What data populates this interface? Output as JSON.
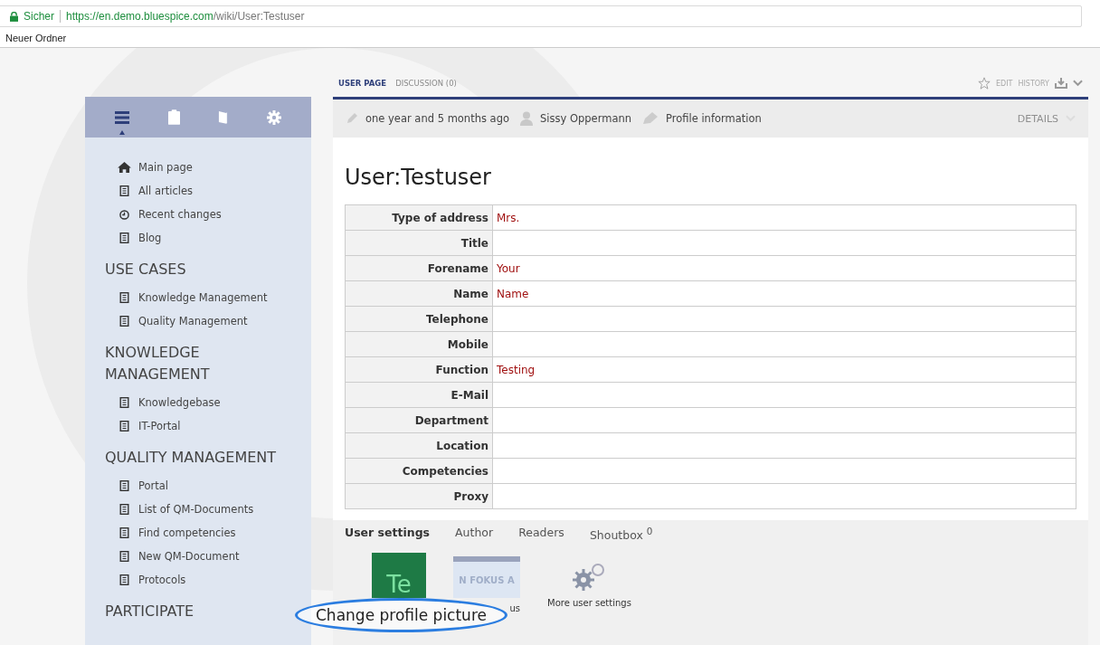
{
  "browser": {
    "secure_label": "Sicher",
    "url_host": "https://en.demo.bluespice.com",
    "url_path": "/wiki/User:Testuser",
    "bookmarks": [
      "Neuer Ordner"
    ]
  },
  "sidebar": {
    "tabs": [
      {
        "kind": "menu",
        "selected": true
      },
      {
        "kind": "clipboard",
        "selected": false
      },
      {
        "kind": "book",
        "selected": false
      },
      {
        "kind": "gear",
        "selected": false
      }
    ],
    "sections": [
      {
        "items": [
          {
            "kind": "home",
            "label": "Main page"
          },
          {
            "kind": "page",
            "label": "All articles"
          },
          {
            "kind": "clock",
            "label": "Recent changes"
          },
          {
            "kind": "page",
            "label": "Blog"
          }
        ]
      },
      {
        "heading": "USE CASES",
        "items": [
          {
            "kind": "page",
            "label": "Knowledge Management"
          },
          {
            "kind": "page",
            "label": "Quality Management"
          }
        ]
      },
      {
        "heading": "KNOWLEDGE MANAGEMENT",
        "items": [
          {
            "kind": "page",
            "label": "Knowledgebase"
          },
          {
            "kind": "page",
            "label": "IT-Portal"
          }
        ]
      },
      {
        "heading": "QUALITY MANAGEMENT",
        "items": [
          {
            "kind": "page",
            "label": "Portal"
          },
          {
            "kind": "page",
            "label": "List of QM-Documents"
          },
          {
            "kind": "page",
            "label": "Find competencies"
          },
          {
            "kind": "page",
            "label": "New QM-Document"
          },
          {
            "kind": "page",
            "label": "Protocols"
          }
        ]
      },
      {
        "heading": "PARTICIPATE"
      }
    ]
  },
  "page_tabs": [
    {
      "label": "USER PAGE",
      "selected": true
    },
    {
      "label": "DISCUSSION (0)",
      "selected": false
    }
  ],
  "page_actions": [
    "EDIT",
    "HISTORY"
  ],
  "meta": {
    "modified": "one year and 5 months ago",
    "author": "Sissy Oppermann",
    "category": "Profile information",
    "details": "DETAILS"
  },
  "title": "User:Testuser",
  "table": {
    "rows": [
      {
        "label": "Type of address",
        "value": "Mrs."
      },
      {
        "label": "Title"
      },
      {
        "label": "Forename",
        "value": "Your"
      },
      {
        "label": "Name",
        "value": "Name"
      },
      {
        "label": "Telephone"
      },
      {
        "label": "Mobile"
      },
      {
        "label": "Function",
        "value": "Testing"
      },
      {
        "label": "E-Mail"
      },
      {
        "label": "Department"
      },
      {
        "label": "Location"
      },
      {
        "label": "Competencies"
      },
      {
        "label": "Proxy"
      }
    ]
  },
  "bottom_tabs": [
    {
      "label": "User settings",
      "selected": true
    },
    {
      "label": "Author",
      "selected": false
    },
    {
      "label": "Readers",
      "selected": false
    },
    {
      "label": "Shoutbox $^{0}$",
      "selected": false
    }
  ],
  "tiles": [
    {
      "kind": "avatar",
      "image_text": "Te"
    },
    {
      "kind": "thumbnail",
      "image_text": "N FOKUS A",
      "label": "us"
    },
    {
      "kind": "gears",
      "label": "More user settings"
    }
  ],
  "callout": "Change profile picture"
}
